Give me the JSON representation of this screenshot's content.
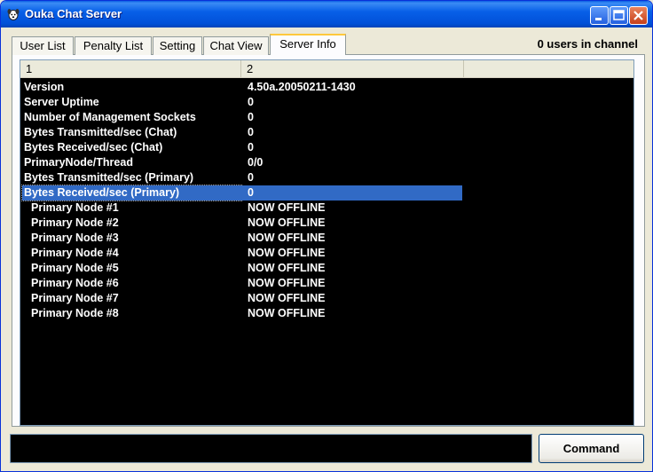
{
  "window": {
    "title": "Ouka Chat Server"
  },
  "tabs": [
    {
      "label": "User List"
    },
    {
      "label": "Penalty List"
    },
    {
      "label": "Setting"
    },
    {
      "label": "Chat View"
    },
    {
      "label": "Server Info"
    }
  ],
  "status": {
    "users_in_channel": "0 users in channel"
  },
  "list": {
    "columns": [
      {
        "label": "1"
      },
      {
        "label": "2"
      },
      {
        "label": ""
      }
    ],
    "rows": [
      {
        "key": "Version",
        "value": "4.50a.20050211-1430"
      },
      {
        "key": "Server Uptime",
        "value": "0"
      },
      {
        "key": "Number of Management Sockets",
        "value": "0"
      },
      {
        "key": "Bytes Transmitted/sec (Chat)",
        "value": "0"
      },
      {
        "key": "Bytes Received/sec (Chat)",
        "value": "0"
      },
      {
        "key": "PrimaryNode/Thread",
        "value": "0/0"
      },
      {
        "key": "Bytes Transmitted/sec (Primary)",
        "value": "0"
      },
      {
        "key": "Bytes Received/sec (Primary)",
        "value": "0"
      },
      {
        "key": "Primary Node #1",
        "value": "NOW OFFLINE"
      },
      {
        "key": "Primary Node #2",
        "value": "NOW OFFLINE"
      },
      {
        "key": "Primary Node #3",
        "value": "NOW OFFLINE"
      },
      {
        "key": "Primary Node #4",
        "value": "NOW OFFLINE"
      },
      {
        "key": "Primary Node #5",
        "value": "NOW OFFLINE"
      },
      {
        "key": "Primary Node #6",
        "value": "NOW OFFLINE"
      },
      {
        "key": "Primary Node #7",
        "value": "NOW OFFLINE"
      },
      {
        "key": "Primary Node #8",
        "value": "NOW OFFLINE"
      }
    ]
  },
  "command": {
    "input_value": "",
    "button_label": "Command"
  },
  "colors": {
    "titlebar": "#0054e3",
    "list_background": "#000000",
    "list_text": "#ffffff",
    "selection": "#316ac5",
    "active_tab_accent": "#ffc83c"
  },
  "icons": {
    "app": "puppy-icon",
    "minimize": "minimize-icon",
    "maximize": "maximize-icon",
    "close": "close-icon"
  }
}
